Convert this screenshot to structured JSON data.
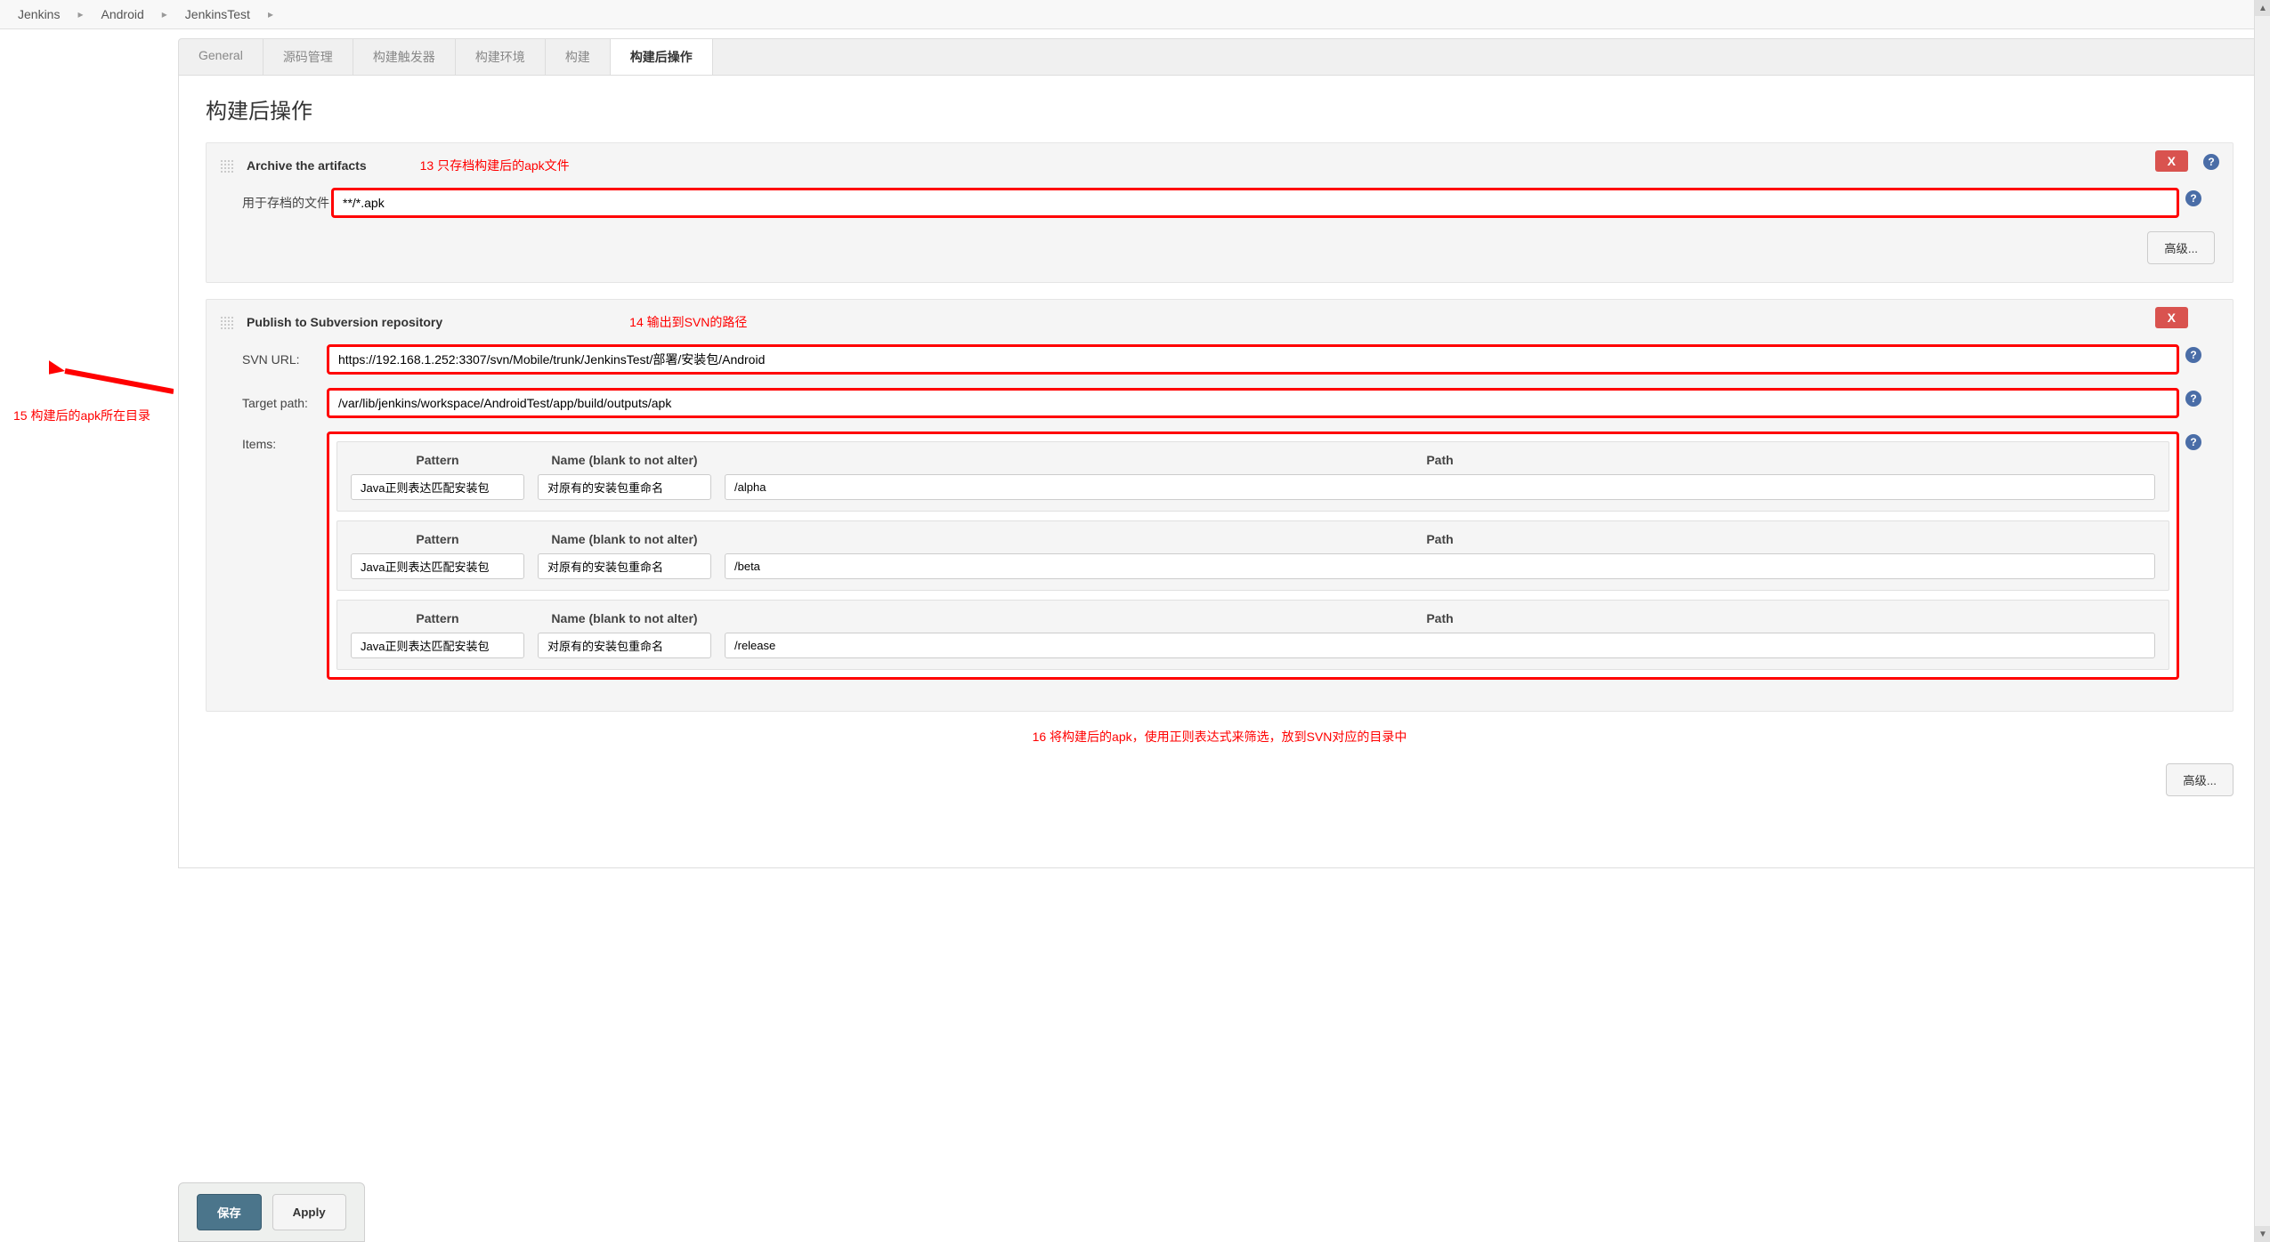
{
  "breadcrumb": {
    "items": [
      "Jenkins",
      "Android",
      "JenkinsTest"
    ]
  },
  "tabs": {
    "general": "General",
    "scm": "源码管理",
    "triggers": "构建触发器",
    "env": "构建环境",
    "build": "构建",
    "post_build": "构建后操作"
  },
  "page": {
    "title": "构建后操作"
  },
  "archive": {
    "title": "Archive the artifacts",
    "files_label": "用于存档的文件",
    "files_value": "**/*.apk",
    "delete_btn": "X",
    "advanced_btn": "高级..."
  },
  "svn": {
    "title": "Publish to Subversion repository",
    "url_label": "SVN URL:",
    "url_value": "https://192.168.1.252:3307/svn/Mobile/trunk/JenkinsTest/部署/安装包/Android",
    "target_label": "Target path:",
    "target_value": "/var/lib/jenkins/workspace/AndroidTest/app/build/outputs/apk",
    "items_label": "Items:",
    "delete_btn": "X",
    "advanced_btn": "高级...",
    "headers": {
      "pattern": "Pattern",
      "name": "Name (blank to not alter)",
      "path": "Path"
    },
    "items": [
      {
        "pattern": "Java正则表达匹配安装包",
        "name": "对原有的安装包重命名",
        "path": "/alpha"
      },
      {
        "pattern": "Java正则表达匹配安装包",
        "name": "对原有的安装包重命名",
        "path": "/beta"
      },
      {
        "pattern": "Java正则表达匹配安装包",
        "name": "对原有的安装包重命名",
        "path": "/release"
      }
    ]
  },
  "annotations": {
    "a13": "13 只存档构建后的apk文件",
    "a14": "14 输出到SVN的路径",
    "a15": "15 构建后的apk所在目录",
    "a16": "16 将构建后的apk，使用正则表达式来筛选，放到SVN对应的目录中"
  },
  "buttons": {
    "save": "保存",
    "apply": "Apply"
  },
  "help_icon": "?"
}
